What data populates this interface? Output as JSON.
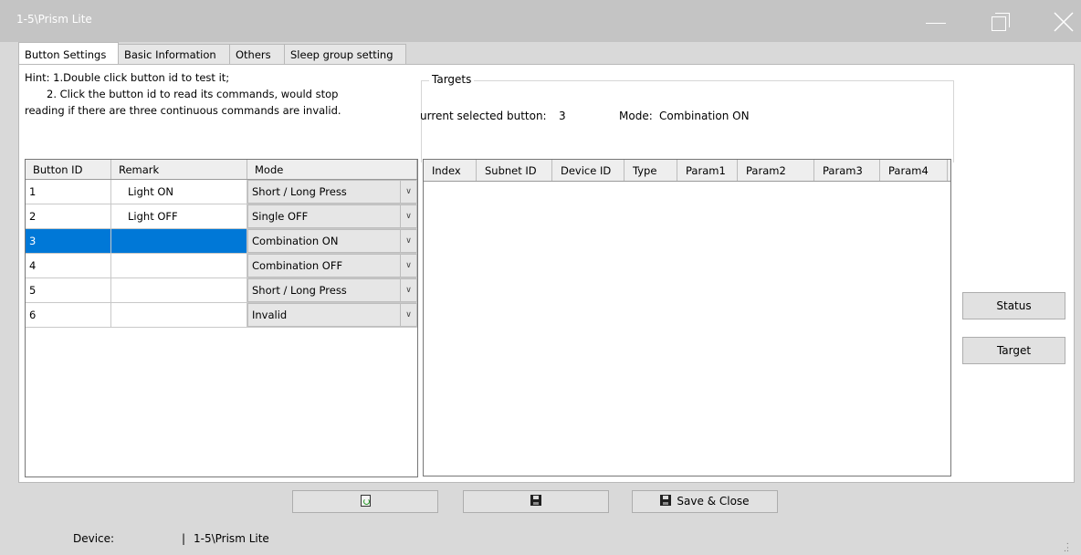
{
  "window": {
    "title": "1-5\\Prism Lite"
  },
  "tabs": [
    {
      "label": "Button Settings",
      "active": true
    },
    {
      "label": "Basic Information",
      "active": false
    },
    {
      "label": "Others",
      "active": false
    },
    {
      "label": "Sleep group setting",
      "active": false
    }
  ],
  "hint": {
    "line1": "Hint:  1.Double click button id to test it;",
    "line2": "2. Click the button id to read its commands, would stop",
    "line3": "reading if there are three continuous commands are invalid."
  },
  "buttons_table": {
    "headers": [
      "Button ID",
      "Remark",
      "Mode"
    ],
    "rows": [
      {
        "id": "1",
        "remark": "Light ON",
        "mode": "Short / Long Press"
      },
      {
        "id": "2",
        "remark": "Light OFF",
        "mode": "Single OFF"
      },
      {
        "id": "3",
        "remark": "",
        "mode": "Combination ON",
        "selected": true
      },
      {
        "id": "4",
        "remark": "",
        "mode": "Combination OFF"
      },
      {
        "id": "5",
        "remark": "",
        "mode": "Short / Long Press"
      },
      {
        "id": "6",
        "remark": "",
        "mode": "Invalid"
      }
    ]
  },
  "targets": {
    "legend": "Targets",
    "current_label": "urrent selected button:",
    "current_value": "3",
    "mode_label": "Mode:",
    "mode_value": "Combination ON",
    "headers": [
      "Index",
      "Subnet ID",
      "Device ID",
      "Type",
      "Param1",
      "Param2",
      "Param3",
      "Param4"
    ]
  },
  "side_buttons": {
    "status": "Status",
    "target": "Target"
  },
  "bottom_buttons": {
    "save_close": "Save & Close"
  },
  "status_bar": {
    "device_label": "Device:",
    "separator": "|",
    "device_value": "1-5\\Prism Lite"
  },
  "icons": {
    "refresh": "refresh-icon",
    "save": "floppy-disk-icon",
    "dropdown": "chevron-down-icon"
  },
  "colors": {
    "selection": "#0078d7",
    "titlebar": "#c4c4c4"
  }
}
